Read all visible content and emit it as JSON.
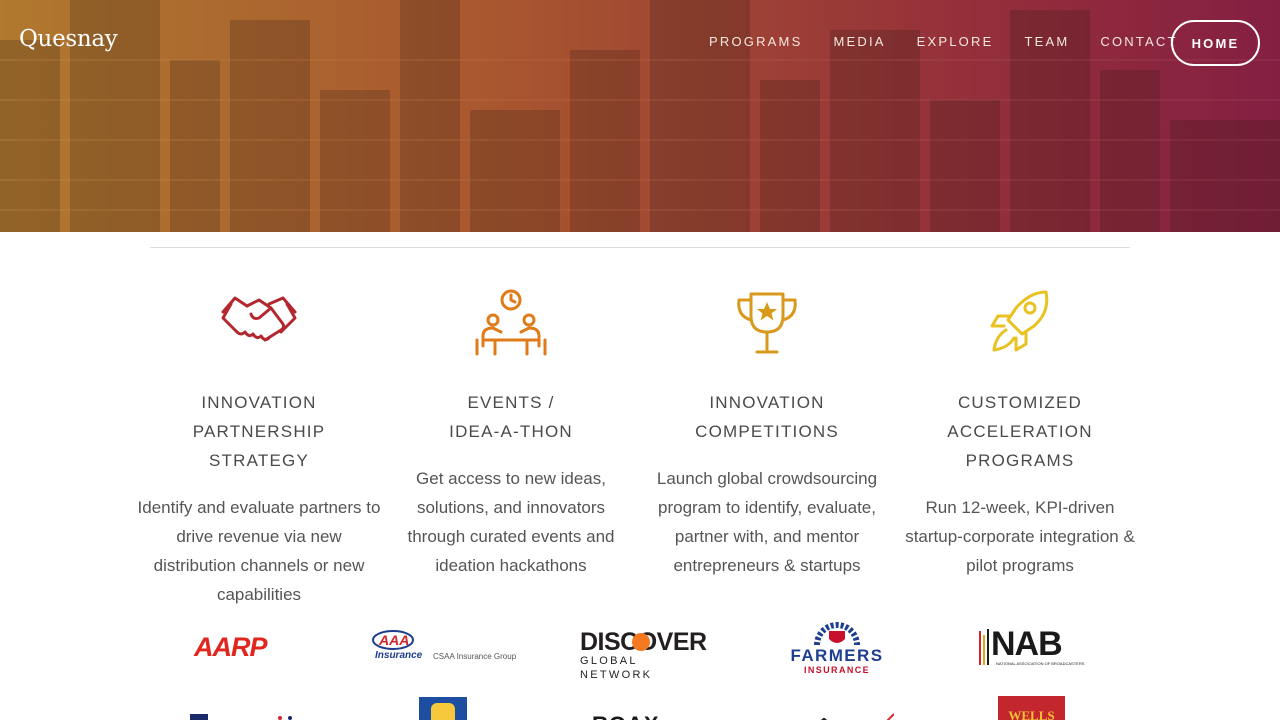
{
  "brand": {
    "name": "Quesnay"
  },
  "nav": {
    "links": [
      "PROGRAMS",
      "MEDIA",
      "EXPLORE",
      "TEAM",
      "CONTACT"
    ],
    "home_label": "HOME"
  },
  "colors": {
    "hero_gradient_start": "#b0792f",
    "hero_gradient_end": "#851f42",
    "icon_red": "#b3282e",
    "icon_orange": "#e07b1a",
    "icon_amber": "#d99a1c",
    "icon_yellow": "#e9c21f"
  },
  "features": [
    {
      "icon": "handshake-icon",
      "title": "INNOVATION PARTNERSHIP\nSTRATEGY",
      "description": "Identify and evaluate partners to drive revenue via new distribution channels or new capabilities"
    },
    {
      "icon": "meeting-table-icon",
      "title": "EVENTS /\nIDEA-A-THON",
      "description": "Get access to new ideas, solutions, and innovators through curated events and ideation hackathons"
    },
    {
      "icon": "trophy-icon",
      "title": "INNOVATION\nCOMPETITIONS",
      "description": "Launch global crowdsourcing program to identify, evaluate, partner with, and mentor entrepreneurs & startups"
    },
    {
      "icon": "rocket-icon",
      "title": "CUSTOMIZED\nACCELERATION PROGRAMS",
      "description": "Run 12-week, KPI-driven startup-corporate integration & pilot programs"
    }
  ],
  "partner_logos": {
    "aarp": "AARP",
    "aaa_primary": "Insurance",
    "aaa_secondary": "CSAA Insurance Group",
    "discover_main": "DISCOVER",
    "discover_sub": "GLOBAL NETWORK",
    "farmers_main": "FARMERS",
    "farmers_sub": "INSURANCE",
    "nab_main": "NAB",
    "nab_sub": "NATIONAL ASSOCIATION OF BROADCASTERS",
    "wells": "WELLS",
    "roax": "ROAX"
  }
}
